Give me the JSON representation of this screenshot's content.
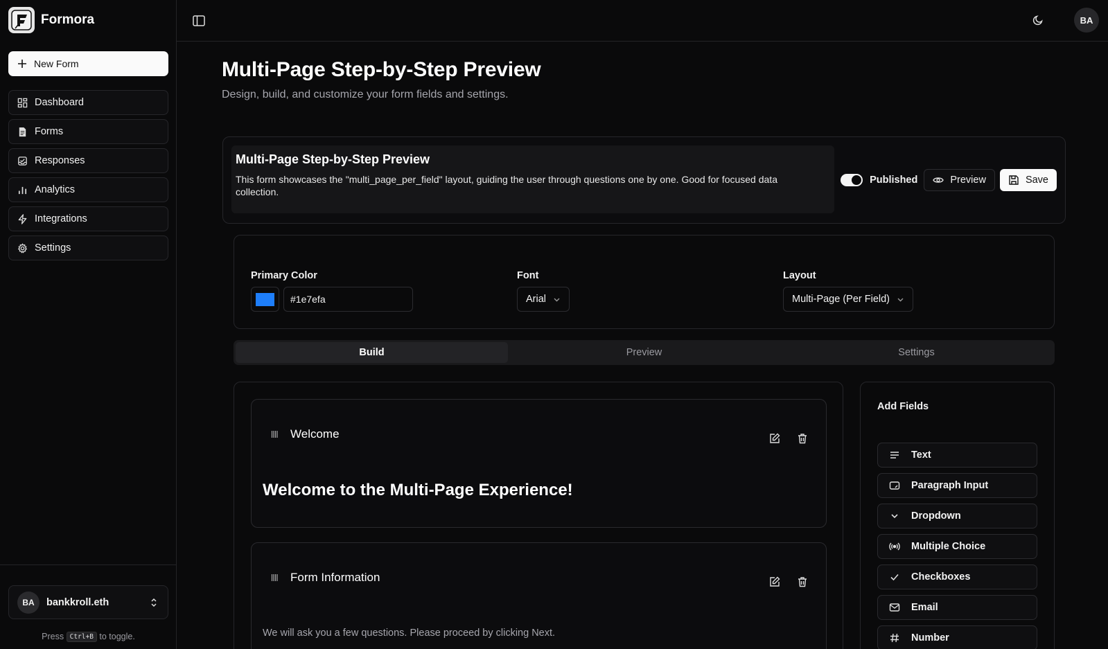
{
  "app": {
    "name": "Formora",
    "new_form_label": "New Form",
    "user_initials": "BA"
  },
  "sidebar": {
    "items": [
      {
        "label": "Dashboard",
        "icon": "dashboard-icon"
      },
      {
        "label": "Forms",
        "icon": "file-icon"
      },
      {
        "label": "Responses",
        "icon": "inbox-icon"
      },
      {
        "label": "Analytics",
        "icon": "bar-chart-icon"
      },
      {
        "label": "Integrations",
        "icon": "zap-icon"
      },
      {
        "label": "Settings",
        "icon": "gear-icon"
      }
    ],
    "user": {
      "initials": "BA",
      "name": "bankkroll.eth"
    },
    "toggle_hint": {
      "before": "Press",
      "key": "Ctrl+B",
      "after": "to toggle."
    }
  },
  "header": {
    "title": "Multi-Page Step-by-Step Preview",
    "subtitle": "Design, build, and customize your form fields and settings."
  },
  "form": {
    "name": "Multi-Page Step-by-Step Preview",
    "description": "This form showcases the \"multi_page_per_field\" layout, guiding the user through questions one by one. Good for focused data collection.",
    "published_label": "Published",
    "published": true,
    "preview_label": "Preview",
    "save_label": "Save"
  },
  "settings": {
    "primary_color_label": "Primary Color",
    "primary_color": "#1e7efa",
    "font_label": "Font",
    "font_value": "Arial",
    "layout_label": "Layout",
    "layout_value": "Multi-Page (Per Field)"
  },
  "tabs": [
    {
      "label": "Build",
      "active": true
    },
    {
      "label": "Preview",
      "active": false
    },
    {
      "label": "Settings",
      "active": false
    }
  ],
  "fields": [
    {
      "title": "Welcome",
      "content": "Welcome to the Multi-Page Experience!"
    },
    {
      "title": "Form Information",
      "content": "We will ask you a few questions. Please proceed by clicking Next."
    }
  ],
  "add_fields": {
    "title": "Add Fields",
    "items": [
      {
        "label": "Text",
        "icon": "text-lines-icon"
      },
      {
        "label": "Paragraph Input",
        "icon": "textarea-icon"
      },
      {
        "label": "Dropdown",
        "icon": "chevron-down-icon"
      },
      {
        "label": "Multiple Choice",
        "icon": "radio-icon"
      },
      {
        "label": "Checkboxes",
        "icon": "check-icon"
      },
      {
        "label": "Email",
        "icon": "mail-icon"
      },
      {
        "label": "Number",
        "icon": "hash-icon"
      }
    ]
  }
}
